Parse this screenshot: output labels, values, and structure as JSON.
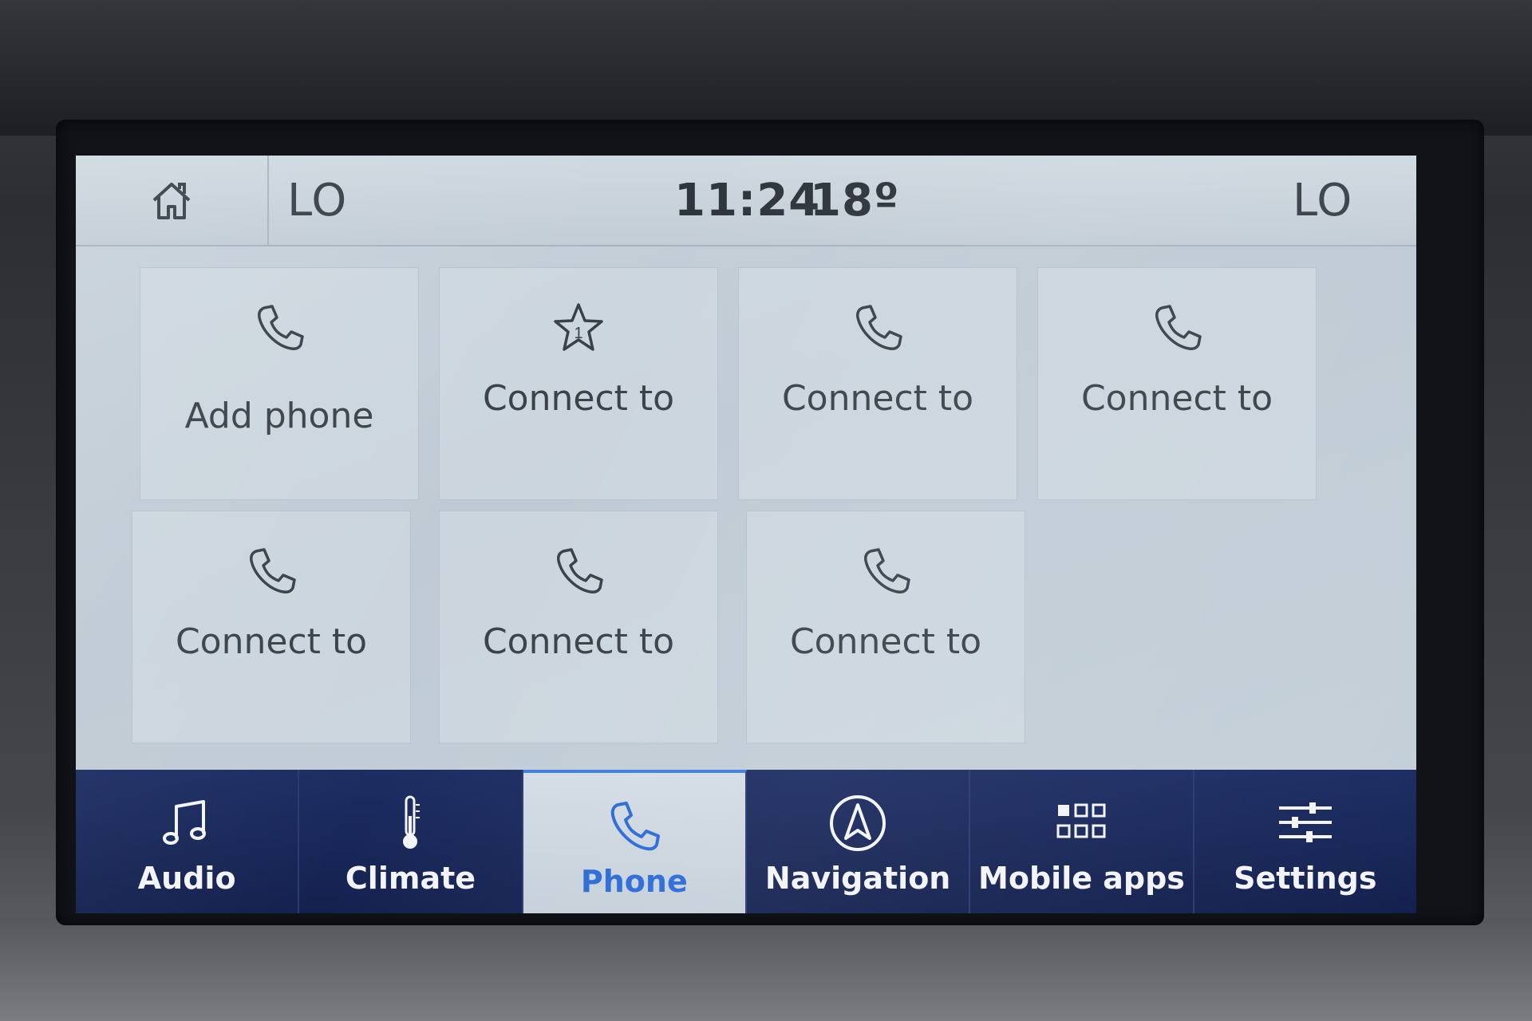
{
  "status_bar": {
    "left_temp": "LO",
    "time": "11:24",
    "outside_temp": "18º",
    "right_temp": "LO",
    "home_icon": "home-icon"
  },
  "tiles": [
    {
      "label": "Add phone",
      "icon": "phone-icon"
    },
    {
      "label": "Connect to",
      "icon": "star-1-icon"
    },
    {
      "label": "Connect to",
      "icon": "phone-icon"
    },
    {
      "label": "Connect to",
      "icon": "phone-icon"
    },
    {
      "label": "Connect to",
      "icon": "phone-icon"
    },
    {
      "label": "Connect to",
      "icon": "phone-icon"
    },
    {
      "label": "Connect to",
      "icon": "phone-icon"
    }
  ],
  "nav": [
    {
      "label": "Audio",
      "icon": "music-note-icon"
    },
    {
      "label": "Climate",
      "icon": "thermometer-icon"
    },
    {
      "label": "Phone",
      "icon": "phone-icon",
      "active": true
    },
    {
      "label": "Navigation",
      "icon": "compass-arrow-icon"
    },
    {
      "label": "Mobile apps",
      "icon": "apps-grid-icon"
    },
    {
      "label": "Settings",
      "icon": "sliders-icon"
    }
  ],
  "colors": {
    "nav_bg": "#1d2d63",
    "active_accent": "#2a6ad6",
    "screen_bg": "#c9d3dc"
  }
}
